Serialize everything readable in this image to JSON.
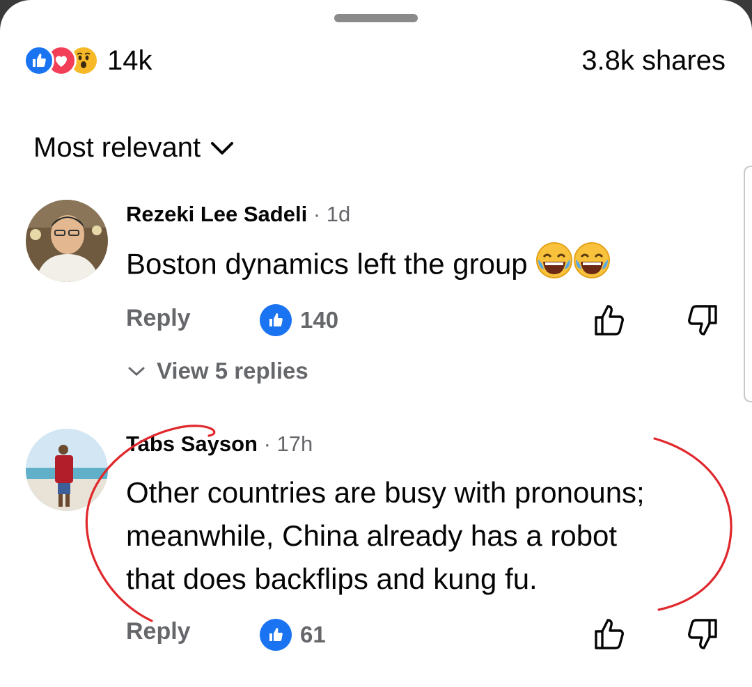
{
  "header": {
    "reaction_icons": [
      "like-icon",
      "love-icon",
      "wow-icon"
    ],
    "reaction_count": "14k",
    "shares": "3.8k shares"
  },
  "sort": {
    "label": "Most relevant"
  },
  "comments": [
    {
      "author": "Rezeki Lee Sadeli",
      "time": "· 1d",
      "text": "Boston dynamics left the group",
      "emojis": [
        "laughing-tears-emoji",
        "laughing-tears-emoji"
      ],
      "reply_label": "Reply",
      "like_count": "140",
      "view_replies": "View 5 replies"
    },
    {
      "author": "Tabs Sayson",
      "time": "· 17h",
      "text_lines": [
        "Other countries are busy with pronouns;",
        "meanwhile, China already has a robot",
        "that does backflips and kung fu."
      ],
      "reply_label": "Reply",
      "like_count": "61"
    }
  ],
  "colors": {
    "like_blue": "#1a74f2",
    "love_red": "#f33e58",
    "wow_yellow": "#f7b928",
    "secondary_text": "#65676b",
    "annotation_red": "#e0272b"
  }
}
